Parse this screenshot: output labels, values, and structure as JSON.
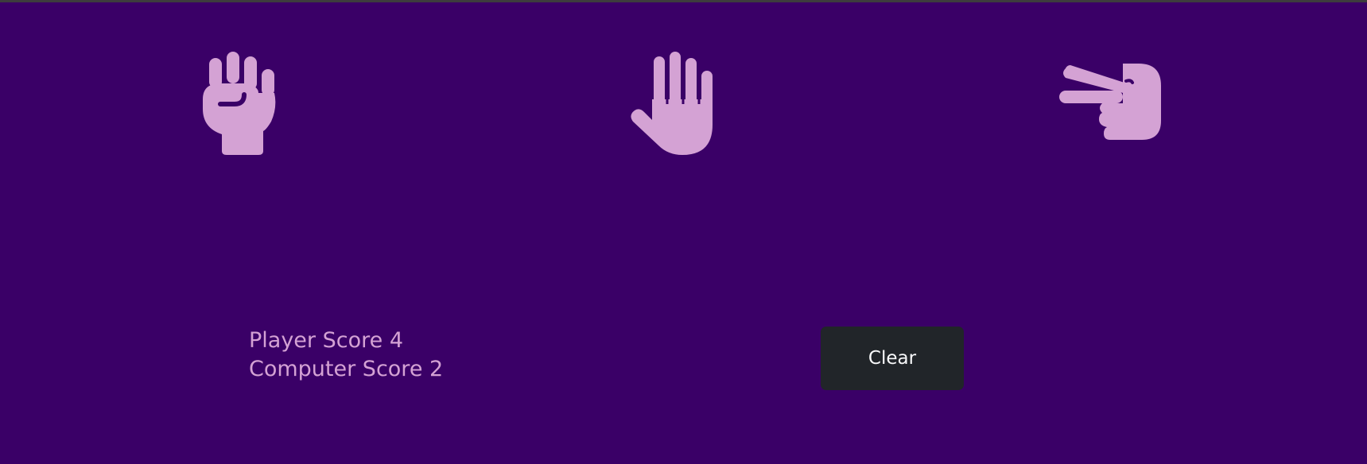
{
  "choices": [
    {
      "id": "rock",
      "icon": "hand-fist-icon"
    },
    {
      "id": "paper",
      "icon": "hand-paper-icon"
    },
    {
      "id": "scissors",
      "icon": "hand-scissors-icon"
    }
  ],
  "scores": {
    "player_label": "Player Score",
    "player_value": "4",
    "computer_label": "Computer Score",
    "computer_value": "2"
  },
  "clear_button": {
    "label": "Clear"
  },
  "colors": {
    "background": "#3a0067",
    "icon": "#d4a2d4",
    "score_text": "#d4a2d4",
    "button_bg": "#212529",
    "button_text": "#f8f9fa"
  }
}
